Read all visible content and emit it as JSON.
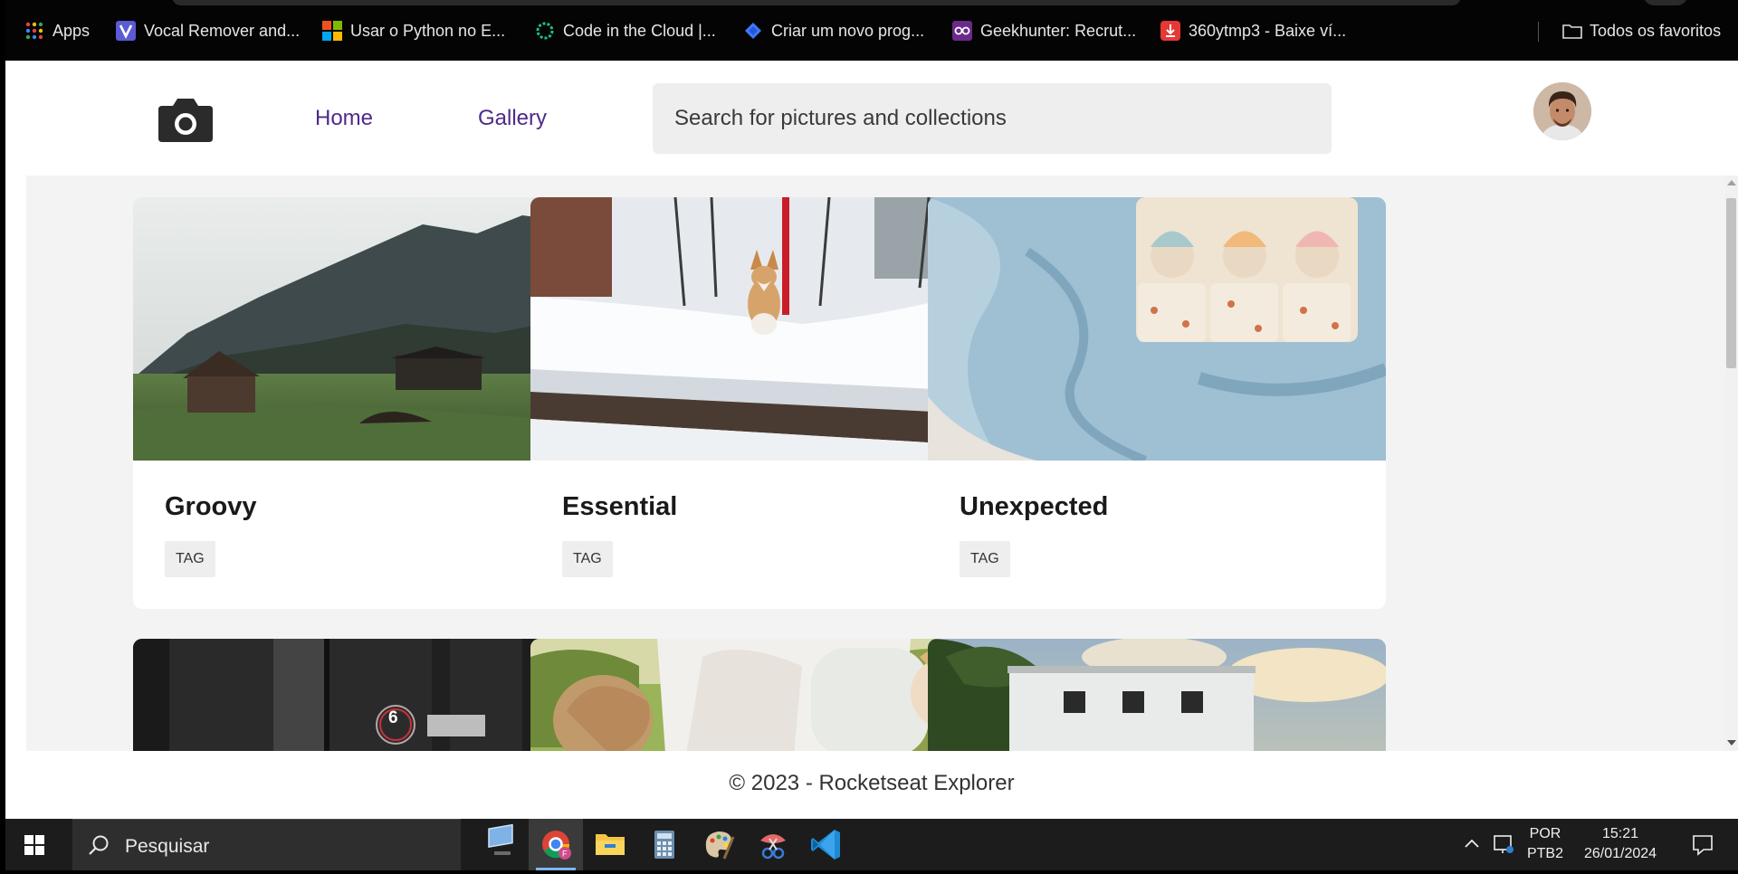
{
  "browser": {
    "bookmarks": [
      {
        "label": "Apps",
        "icon": "apps-grid-icon"
      },
      {
        "label": "Vocal Remover and...",
        "icon": "vocal-remover-icon"
      },
      {
        "label": "Usar o Python no E...",
        "icon": "microsoft-icon"
      },
      {
        "label": "Code in the Cloud |...",
        "icon": "replit-icon"
      },
      {
        "label": "Criar um novo prog...",
        "icon": "diamond-icon"
      },
      {
        "label": "Geekhunter: Recrut...",
        "icon": "geekhunter-icon"
      },
      {
        "label": "360ytmp3 - Baixe ví...",
        "icon": "download-icon"
      },
      {
        "label": "Todos os favoritos",
        "icon": "folder-icon"
      }
    ]
  },
  "header": {
    "logo_icon": "camera-icon",
    "nav": {
      "home": "Home",
      "gallery": "Gallery"
    },
    "search_placeholder": "Search for pictures and collections",
    "avatar": "user-avatar"
  },
  "cards": [
    {
      "title": "Groovy",
      "tag": "TAG",
      "photo": "mountain-meadow-with-huts"
    },
    {
      "title": "Essential",
      "tag": "TAG",
      "photo": "corgi-on-snowy-steps"
    },
    {
      "title": "Unexpected",
      "tag": "TAG",
      "photo": "crochet-dolls-in-blue-blanket"
    },
    {
      "photo": "dark-elevator-door-floor-6"
    },
    {
      "photo": "children-playing-outdoors"
    },
    {
      "photo": "white-building-with-sky"
    }
  ],
  "card4_badge": "6",
  "footer": {
    "text": "© 2023 - Rocketseat Explorer"
  },
  "taskbar": {
    "search_placeholder": "Pesquisar",
    "apps": [
      "desktop-icon",
      "chrome-icon",
      "file-explorer-icon",
      "calculator-icon",
      "paint-icon",
      "snipping-tool-icon",
      "vscode-icon"
    ],
    "language": {
      "line1": "POR",
      "line2": "PTB2"
    },
    "time": "15:21",
    "date": "26/01/2024"
  },
  "colors": {
    "nav_link": "#4f2a8a",
    "gallery_bg": "#f3f3f3",
    "tag_bg": "#eeeeee",
    "taskbar": "#1c1c1c"
  }
}
